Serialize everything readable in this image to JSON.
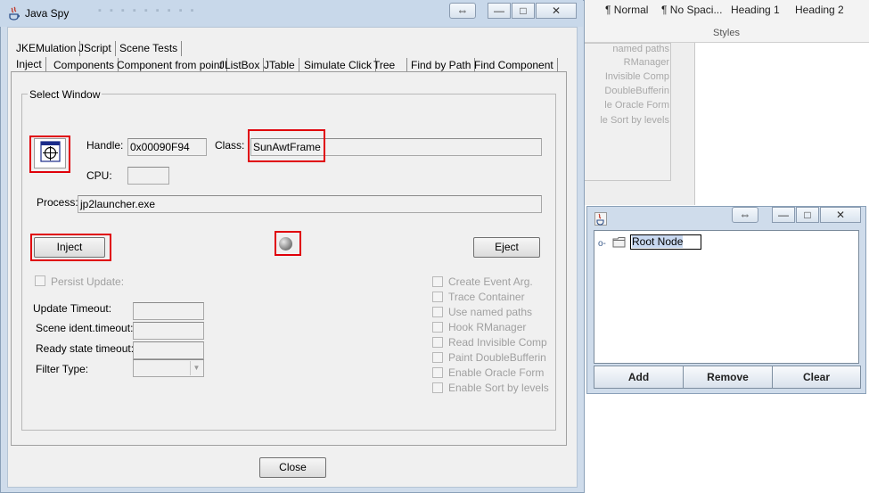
{
  "ribbon": {
    "styles": [
      "¶ Normal",
      "¶ No Spaci...",
      "Heading 1",
      "Heading 2"
    ],
    "group_label": "Styles"
  },
  "background_list": [
    "named paths",
    "RManager",
    "Invisible Comp",
    "DoubleBufferin",
    "le Oracle Form",
    "le Sort by levels"
  ],
  "spy": {
    "title": "Java Spy",
    "tabs_row1": [
      "JKEMulation",
      "JScript",
      "Scene Tests"
    ],
    "tabs_row2": [
      "Inject",
      "Components",
      "Component from point",
      "JListBox",
      "JTable",
      "Simulate Click",
      "Tree",
      "Find by Path",
      "Find Component"
    ],
    "active_tab": "Inject",
    "select_window": {
      "group_label": "Select Window",
      "handle_label": "Handle:",
      "handle_value": "0x00090F94",
      "class_label": "Class:",
      "class_value": "SunAwtFrame",
      "cpu_label": "CPU:",
      "cpu_value": "",
      "process_label": "Process:",
      "process_value": "jp2launcher.exe"
    },
    "inject_label": "Inject",
    "eject_label": "Eject",
    "persist_update_label": "Persist Update:",
    "update_timeout_label": "Update Timeout:",
    "scene_ident_label": "Scene ident.timeout:",
    "ready_state_label": "Ready state timeout:",
    "filter_type_label": "Filter Type:",
    "options": [
      "Create Event Arg.",
      "Trace Container",
      "Use named paths",
      "Hook RManager",
      "Read Invisible Comp",
      "Paint DoubleBufferin",
      "Enable Oracle Form",
      "Enable Sort by levels"
    ],
    "close_label": "Close",
    "window_buttons": {
      "swap": "⇔",
      "minimize": "—",
      "maximize": "□",
      "close": "✕"
    }
  },
  "tree_window": {
    "root_node": "Root Node",
    "add_label": "Add",
    "remove_label": "Remove",
    "clear_label": "Clear",
    "window_buttons": {
      "swap": "⇔",
      "minimize": "—",
      "maximize": "□",
      "close": "✕"
    }
  },
  "colors": {
    "highlight_box": "#e0000a",
    "window_frame": "#cfdceb",
    "selection": "#c8d8f0"
  }
}
